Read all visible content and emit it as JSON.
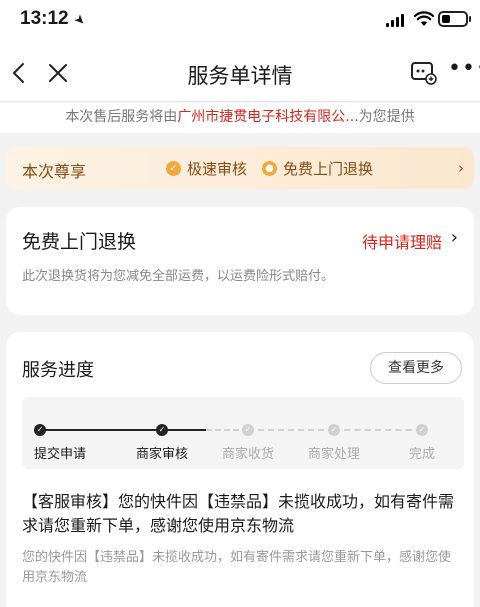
{
  "status_bar": {
    "time": "13:12"
  },
  "nav": {
    "title": "服务单详情"
  },
  "provider": {
    "prefix": "本次售后服务将由",
    "name": "广州市捷贯电子科技有限公...",
    "suffix": "为您提供"
  },
  "enjoy": {
    "title": "本次尊享",
    "items": [
      "极速审核",
      "免费上门退换"
    ]
  },
  "return_card": {
    "title": "免费上门退换",
    "status": "待申请理赔",
    "desc": "此次退换货将为您减免全部运费，以运费险形式赔付。"
  },
  "progress_card": {
    "title": "服务进度",
    "more_label": "查看更多",
    "steps": [
      {
        "label": "提交申请",
        "done": true
      },
      {
        "label": "商家审核",
        "done": true
      },
      {
        "label": "商家收货",
        "done": false
      },
      {
        "label": "商家处理",
        "done": false
      },
      {
        "label": "完成",
        "done": false
      }
    ],
    "detail_title": "【客服审核】您的快件因【违禁品】未揽收成功，如有寄件需求请您重新下单，感谢您使用京东物流",
    "detail_desc": "您的快件因【违禁品】未揽收成功，如有寄件需求请您重新下单，感谢您使用京东物流"
  },
  "colors": {
    "accent": "#e2231a",
    "gold": "#8a4b12",
    "badge": "#f4a83b"
  }
}
